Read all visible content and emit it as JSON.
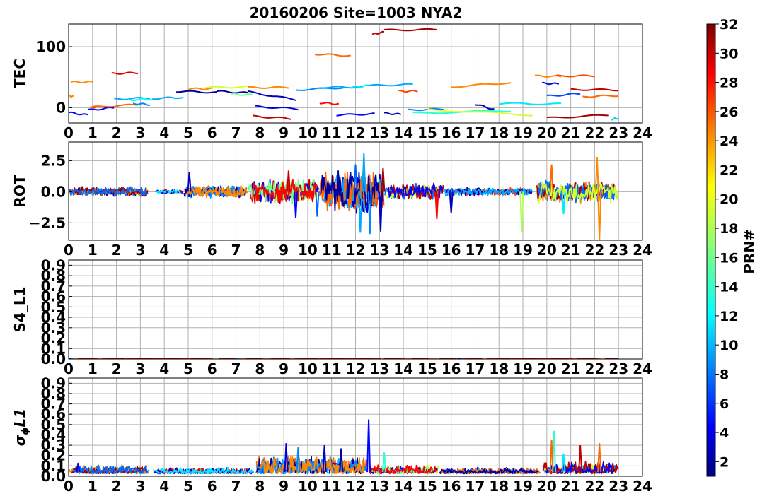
{
  "figure": {
    "title": "20160206 Site=1003 NYA2",
    "colorbar": {
      "label": "PRN#",
      "min": 1,
      "max": 32,
      "ticks": [
        2,
        4,
        6,
        8,
        10,
        12,
        14,
        16,
        18,
        20,
        22,
        24,
        26,
        28,
        30,
        32
      ],
      "colormap": "jet"
    }
  },
  "chart_data": [
    {
      "type": "line",
      "panel": "TEC",
      "ylabel": "TEC",
      "xlim": [
        0,
        24
      ],
      "ylim": [
        -25,
        137
      ],
      "xticks": [
        0,
        1,
        2,
        3,
        4,
        5,
        6,
        7,
        8,
        9,
        10,
        11,
        12,
        13,
        14,
        15,
        16,
        17,
        18,
        19,
        20,
        21,
        22,
        23,
        24
      ],
      "yticks": [
        0,
        100
      ],
      "ytick_labels": [
        "0",
        "100"
      ],
      "grid": true,
      "segments": [
        {
          "prn": 24,
          "x": [
            0.0,
            0.2
          ],
          "y": [
            19,
            18
          ]
        },
        {
          "prn": 24,
          "x": [
            0.1,
            1.0
          ],
          "y": [
            42,
            42
          ]
        },
        {
          "prn": 5,
          "x": [
            0.0,
            0.8
          ],
          "y": [
            -8,
            -12
          ]
        },
        {
          "prn": 5,
          "x": [
            0.8,
            1.9
          ],
          "y": [
            -4,
            0
          ]
        },
        {
          "prn": 26,
          "x": [
            0.9,
            1.3
          ],
          "y": [
            0,
            2
          ]
        },
        {
          "prn": 25,
          "x": [
            1.0,
            2.9
          ],
          "y": [
            1,
            5
          ]
        },
        {
          "prn": 29,
          "x": [
            1.8,
            2.9
          ],
          "y": [
            56,
            57
          ]
        },
        {
          "prn": 10,
          "x": [
            1.9,
            3.4
          ],
          "y": [
            14,
            16
          ]
        },
        {
          "prn": 9,
          "x": [
            2.7,
            3.4
          ],
          "y": [
            7,
            5
          ]
        },
        {
          "prn": 13,
          "x": [
            2.5,
            3.5
          ],
          "y": [
            13,
            14
          ]
        },
        {
          "prn": 10,
          "x": [
            3.5,
            4.8
          ],
          "y": [
            15,
            17
          ]
        },
        {
          "prn": 2,
          "x": [
            4.5,
            6.2
          ],
          "y": [
            27,
            25
          ]
        },
        {
          "prn": 19,
          "x": [
            5.7,
            7.6
          ],
          "y": [
            33,
            34
          ]
        },
        {
          "prn": 24,
          "x": [
            5.0,
            6.0
          ],
          "y": [
            31,
            31
          ]
        },
        {
          "prn": 2,
          "x": [
            6.2,
            7.5
          ],
          "y": [
            27,
            24
          ]
        },
        {
          "prn": 16,
          "x": [
            6.8,
            7.7
          ],
          "y": [
            22,
            21
          ]
        },
        {
          "prn": 3,
          "x": [
            7.5,
            9.5
          ],
          "y": [
            26,
            13
          ]
        },
        {
          "prn": 24,
          "x": [
            7.5,
            9.2
          ],
          "y": [
            33,
            33
          ]
        },
        {
          "prn": 30,
          "x": [
            7.7,
            9.3
          ],
          "y": [
            -14,
            -18
          ]
        },
        {
          "prn": 4,
          "x": [
            7.8,
            9.6
          ],
          "y": [
            2,
            -2
          ]
        },
        {
          "prn": 9,
          "x": [
            9.5,
            11.5
          ],
          "y": [
            29,
            33
          ]
        },
        {
          "prn": 28,
          "x": [
            10.5,
            11.3
          ],
          "y": [
            8,
            6
          ]
        },
        {
          "prn": 25,
          "x": [
            10.3,
            11.8
          ],
          "y": [
            88,
            85
          ]
        },
        {
          "prn": 10,
          "x": [
            10.5,
            12.3
          ],
          "y": [
            33,
            34
          ]
        },
        {
          "prn": 5,
          "x": [
            11.2,
            12.8
          ],
          "y": [
            -12,
            -10
          ]
        },
        {
          "prn": 12,
          "x": [
            11.8,
            12.5
          ],
          "y": [
            33,
            36
          ]
        },
        {
          "prn": 30,
          "x": [
            12.7,
            13.2
          ],
          "y": [
            120,
            124
          ]
        },
        {
          "prn": 31,
          "x": [
            13.2,
            15.4
          ],
          "y": [
            127,
            128
          ]
        },
        {
          "prn": 10,
          "x": [
            12.5,
            14.4
          ],
          "y": [
            36,
            38
          ]
        },
        {
          "prn": 3,
          "x": [
            13.2,
            13.9
          ],
          "y": [
            -9,
            -11
          ]
        },
        {
          "prn": 26,
          "x": [
            13.8,
            14.6
          ],
          "y": [
            27,
            27
          ]
        },
        {
          "prn": 9,
          "x": [
            14.2,
            15.7
          ],
          "y": [
            -4,
            -2
          ]
        },
        {
          "prn": 14,
          "x": [
            14.4,
            18.5
          ],
          "y": [
            -9,
            -5
          ]
        },
        {
          "prn": 19,
          "x": [
            15.0,
            19.4
          ],
          "y": [
            -3,
            -12
          ]
        },
        {
          "prn": 24,
          "x": [
            16.0,
            18.5
          ],
          "y": [
            34,
            41
          ]
        },
        {
          "prn": 2,
          "x": [
            17.0,
            17.8
          ],
          "y": [
            6,
            -3
          ]
        },
        {
          "prn": 12,
          "x": [
            18.0,
            20.6
          ],
          "y": [
            7,
            6
          ]
        },
        {
          "prn": 24,
          "x": [
            19.5,
            20.6
          ],
          "y": [
            52,
            51
          ]
        },
        {
          "prn": 26,
          "x": [
            20.4,
            22.0
          ],
          "y": [
            52,
            52
          ]
        },
        {
          "prn": 4,
          "x": [
            19.8,
            20.5
          ],
          "y": [
            40,
            39
          ]
        },
        {
          "prn": 7,
          "x": [
            20.0,
            21.4
          ],
          "y": [
            19,
            23
          ]
        },
        {
          "prn": 31,
          "x": [
            20.0,
            22.6
          ],
          "y": [
            -17,
            -12
          ]
        },
        {
          "prn": 30,
          "x": [
            21.0,
            23.0
          ],
          "y": [
            30,
            29
          ]
        },
        {
          "prn": 25,
          "x": [
            21.5,
            23.0
          ],
          "y": [
            18,
            20
          ]
        },
        {
          "prn": 11,
          "x": [
            22.7,
            23.0
          ],
          "y": [
            -19,
            -17
          ]
        }
      ]
    },
    {
      "type": "line",
      "panel": "ROT",
      "ylabel": "ROT",
      "xlim": [
        0,
        24
      ],
      "ylim": [
        -3.9,
        4.0
      ],
      "xticks": [
        0,
        1,
        2,
        3,
        4,
        5,
        6,
        7,
        8,
        9,
        10,
        11,
        12,
        13,
        14,
        15,
        16,
        17,
        18,
        19,
        20,
        21,
        22,
        23,
        24
      ],
      "yticks": [
        -2.5,
        0.0,
        2.5
      ],
      "ytick_labels": [
        "−2.5",
        "0.0",
        "2.5"
      ],
      "grid": true,
      "activity": [
        {
          "x0": 0,
          "x1": 3.4,
          "level": 0.35
        },
        {
          "x0": 3.6,
          "x1": 4.8,
          "level": 0.15
        },
        {
          "x0": 4.8,
          "x1": 7.5,
          "level": 0.45
        },
        {
          "x0": 7.5,
          "x1": 10.5,
          "level": 0.9
        },
        {
          "x0": 10.5,
          "x1": 13.2,
          "level": 1.6
        },
        {
          "x0": 13.2,
          "x1": 15.7,
          "level": 0.6
        },
        {
          "x0": 15.7,
          "x1": 19.5,
          "level": 0.3
        },
        {
          "x0": 19.5,
          "x1": 23.0,
          "level": 0.8
        }
      ],
      "spikes": [
        {
          "x": 5.05,
          "y": 1.6,
          "prn": 3
        },
        {
          "x": 9.2,
          "y": 1.7,
          "prn": 30
        },
        {
          "x": 9.5,
          "y": -2.1,
          "prn": 5
        },
        {
          "x": 10.4,
          "y": -2.0,
          "prn": 8
        },
        {
          "x": 12.0,
          "y": 2.2,
          "prn": 8
        },
        {
          "x": 12.2,
          "y": -3.3,
          "prn": 10
        },
        {
          "x": 12.35,
          "y": 3.1,
          "prn": 10
        },
        {
          "x": 12.6,
          "y": -3.4,
          "prn": 9
        },
        {
          "x": 13.05,
          "y": -3.2,
          "prn": 3
        },
        {
          "x": 13.15,
          "y": 1.9,
          "prn": 31
        },
        {
          "x": 15.4,
          "y": -2.2,
          "prn": 28
        },
        {
          "x": 16.0,
          "y": -1.7,
          "prn": 3
        },
        {
          "x": 18.95,
          "y": -3.3,
          "prn": 18
        },
        {
          "x": 20.2,
          "y": 2.2,
          "prn": 25
        },
        {
          "x": 20.7,
          "y": -1.8,
          "prn": 12
        },
        {
          "x": 22.1,
          "y": 2.8,
          "prn": 24
        },
        {
          "x": 22.2,
          "y": -3.9,
          "prn": 24
        }
      ]
    },
    {
      "type": "line",
      "panel": "S4_L1",
      "ylabel": "S4_L1",
      "xlim": [
        0,
        24
      ],
      "ylim": [
        0.0,
        0.95
      ],
      "xticks": [
        0,
        1,
        2,
        3,
        4,
        5,
        6,
        7,
        8,
        9,
        10,
        11,
        12,
        13,
        14,
        15,
        16,
        17,
        18,
        19,
        20,
        21,
        22,
        23,
        24
      ],
      "yticks": [
        0.0,
        0.1,
        0.2,
        0.3,
        0.4,
        0.5,
        0.6,
        0.7,
        0.8,
        0.9
      ],
      "ytick_labels": [
        "0.0",
        "0.1",
        "0.2",
        "0.3",
        "0.4",
        "0.5",
        "0.6",
        "0.7",
        "0.8",
        "0.9"
      ],
      "grid": true,
      "baseline": 0.005,
      "x_extent": [
        0,
        23.0
      ]
    },
    {
      "type": "line",
      "panel": "sigma_phi_L1",
      "ylabel": "σ",
      "ylabel_sub": "ϕ",
      "ylabel_tail": "L1",
      "xlim": [
        0,
        24
      ],
      "ylim": [
        0.0,
        0.95
      ],
      "xticks": [
        0,
        1,
        2,
        3,
        4,
        5,
        6,
        7,
        8,
        9,
        10,
        11,
        12,
        13,
        14,
        15,
        16,
        17,
        18,
        19,
        20,
        21,
        22,
        23,
        24
      ],
      "yticks": [
        0.0,
        0.1,
        0.2,
        0.3,
        0.4,
        0.5,
        0.6,
        0.7,
        0.8,
        0.9
      ],
      "ytick_labels": [
        "0.0",
        "0.1",
        "0.2",
        "0.3",
        "0.4",
        "0.5",
        "0.6",
        "0.7",
        "0.8",
        "0.9"
      ],
      "grid": true,
      "activity": [
        {
          "x0": 0,
          "x1": 3.4,
          "level": 0.06
        },
        {
          "x0": 3.5,
          "x1": 7.8,
          "level": 0.04
        },
        {
          "x0": 7.8,
          "x1": 12.5,
          "level": 0.12
        },
        {
          "x0": 12.5,
          "x1": 15.5,
          "level": 0.06
        },
        {
          "x0": 15.5,
          "x1": 19.8,
          "level": 0.04
        },
        {
          "x0": 19.8,
          "x1": 23.0,
          "level": 0.08
        }
      ],
      "spikes": [
        {
          "x": 0.4,
          "y": 0.13,
          "prn": 4
        },
        {
          "x": 9.1,
          "y": 0.32,
          "prn": 4
        },
        {
          "x": 9.6,
          "y": 0.28,
          "prn": 9
        },
        {
          "x": 10.7,
          "y": 0.3,
          "prn": 3
        },
        {
          "x": 11.4,
          "y": 0.27,
          "prn": 2
        },
        {
          "x": 12.55,
          "y": 0.55,
          "prn": 5
        },
        {
          "x": 13.2,
          "y": 0.23,
          "prn": 14
        },
        {
          "x": 20.3,
          "y": 0.44,
          "prn": 14
        },
        {
          "x": 20.2,
          "y": 0.35,
          "prn": 25
        },
        {
          "x": 20.7,
          "y": 0.22,
          "prn": 12
        },
        {
          "x": 21.4,
          "y": 0.3,
          "prn": 30
        },
        {
          "x": 22.2,
          "y": 0.32,
          "prn": 25
        }
      ]
    }
  ]
}
